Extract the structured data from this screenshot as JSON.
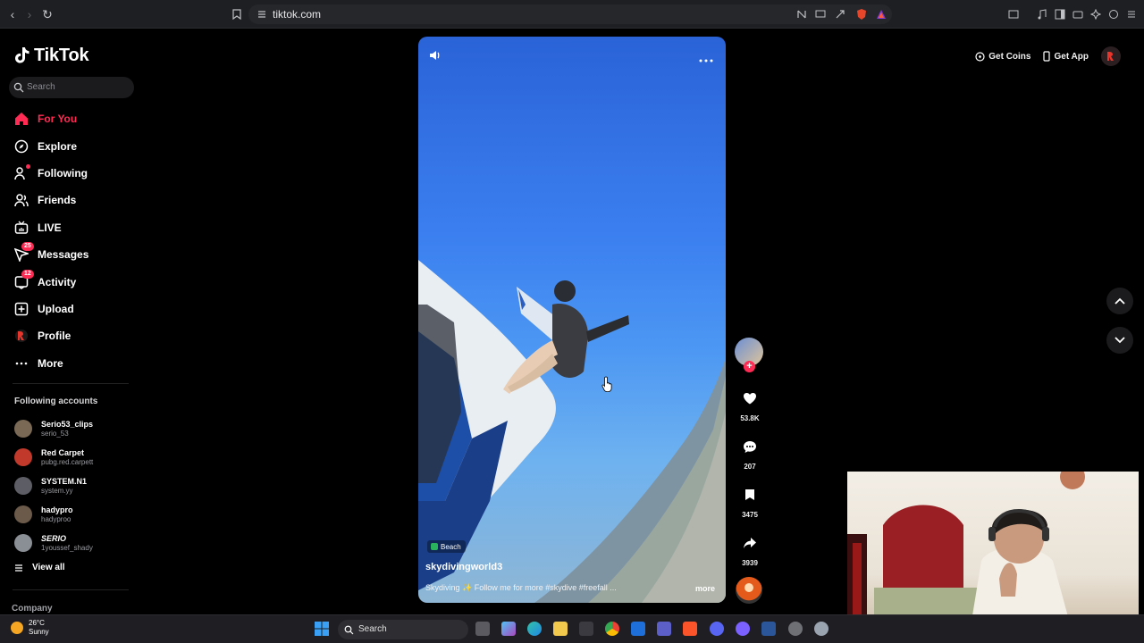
{
  "browser": {
    "url": "tiktok.com",
    "icons": [
      "back-icon",
      "forward-icon",
      "reload-icon",
      "bookmark-icon",
      "site-info-icon"
    ]
  },
  "sidebar": {
    "logo_text": "TikTok",
    "search_placeholder": "Search",
    "nav": [
      {
        "label": "For You",
        "icon": "home-icon",
        "active": true
      },
      {
        "label": "Explore",
        "icon": "compass-icon"
      },
      {
        "label": "Following",
        "icon": "following-icon"
      },
      {
        "label": "Friends",
        "icon": "friends-icon"
      },
      {
        "label": "LIVE",
        "icon": "live-icon"
      },
      {
        "label": "Messages",
        "icon": "messages-icon",
        "badge": "25"
      },
      {
        "label": "Activity",
        "icon": "activity-icon",
        "badge": "12"
      },
      {
        "label": "Upload",
        "icon": "upload-icon"
      },
      {
        "label": "Profile",
        "icon": "profile-icon"
      },
      {
        "label": "More",
        "icon": "more-icon"
      }
    ],
    "following_title": "Following accounts",
    "accounts": [
      {
        "name": "Serio53_clips",
        "handle": "serio_53",
        "color": "#7a6a55"
      },
      {
        "name": "Red Carpet",
        "handle": "pubg.red.carpett",
        "color": "#c0392b"
      },
      {
        "name": "SYSTEM.N1 ",
        "handle": "system.yy",
        "color": "#5d5d66"
      },
      {
        "name": "hadypro",
        "handle": "hadyproo",
        "color": "#6b5a4a"
      },
      {
        "name": "SERIO",
        "handle": "1youssef_shady",
        "color": "#8a8f96"
      }
    ],
    "view_all": "View all",
    "company": "Company"
  },
  "video": {
    "tag": "Beach",
    "author": "skydivingworld3",
    "caption": "Skydiving ✨ Follow me for more #skydive #freefall ...",
    "more": "more",
    "likes": "53.8K",
    "comments": "207",
    "saves": "3475",
    "shares": "3939"
  },
  "topright": {
    "get_coins": "Get Coins",
    "get_app": "Get App"
  },
  "taskbar": {
    "temp": "26°C",
    "condition": "Sunny",
    "search": "Search"
  },
  "colors": {
    "accent": "#fe2c55",
    "background": "#000000"
  }
}
